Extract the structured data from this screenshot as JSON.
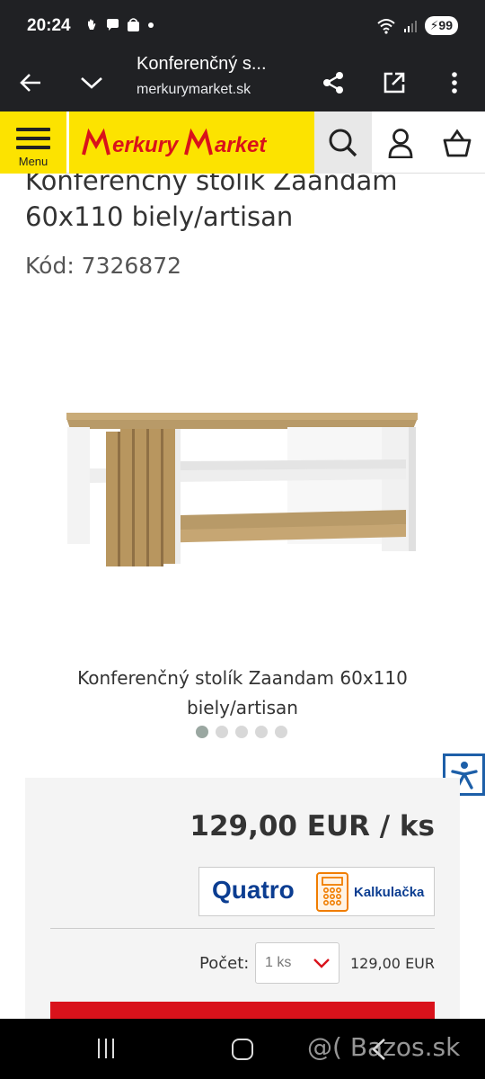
{
  "status": {
    "time": "20:24",
    "battery": "99",
    "network": "5"
  },
  "tab": {
    "title": "Konferenčný s...",
    "url": "merkurymarket.sk"
  },
  "header": {
    "menu_label": "Menu",
    "logo": "MerkuryMarket"
  },
  "product": {
    "title_line1": "Konferenčný stolík Zaandam",
    "title_line2": "60x110 biely/artisan",
    "code": "Kód: 7326872",
    "caption_line1": "Konferenčný stolík Zaandam 60x110",
    "caption_line2": "biely/artisan",
    "image_count": 5,
    "active_image": 1
  },
  "purchase": {
    "price": "129,00 EUR / ks",
    "quatro_brand": "Quatro",
    "quatro_calc": "Kalkulačka",
    "qty_label": "Počet:",
    "qty_value": "1 ks",
    "total": "129,00 EUR"
  },
  "watermark": "@( Bazos.sk",
  "colors": {
    "brand_yellow": "#fce300",
    "brand_red": "#d9121b",
    "accessibility_blue": "#1d5fa8"
  }
}
